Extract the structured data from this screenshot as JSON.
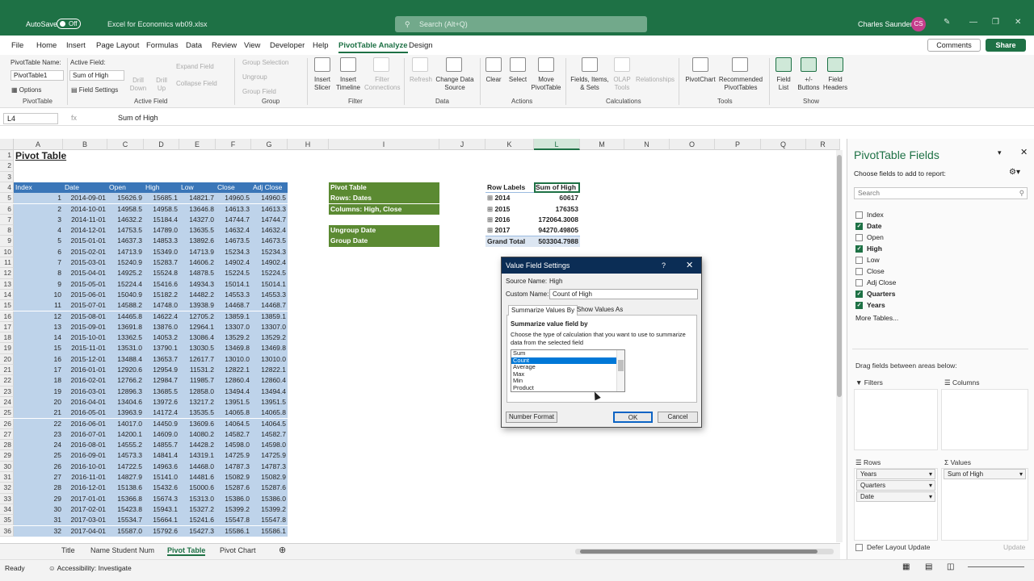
{
  "window": {
    "autosave_label": "AutoSave",
    "autosave_state": "Off",
    "filename": "Excel for Economics wb09.xlsx",
    "search_placeholder": "Search (Alt+Q)",
    "user_name": "Charles Saunders",
    "user_initials": "CS"
  },
  "menu": {
    "tabs": [
      "File",
      "Home",
      "Insert",
      "Page Layout",
      "Formulas",
      "Data",
      "Review",
      "View",
      "Developer",
      "Help",
      "PivotTable Analyze",
      "Design"
    ],
    "active": "PivotTable Analyze",
    "comments": "Comments",
    "share": "Share"
  },
  "ribbon": {
    "pivot_name_label": "PivotTable Name:",
    "pivot_name": "PivotTable1",
    "options": "Options",
    "group_pivot": "PivotTable",
    "active_field_label": "Active Field:",
    "active_field": "Sum of High",
    "field_settings": "Field Settings",
    "drill_down": "Drill Down",
    "drill_up": "Drill Up",
    "expand_field": "Expand Field",
    "collapse_field": "Collapse Field",
    "group_active": "Active Field",
    "group_selection": "Group Selection",
    "ungroup": "Ungroup",
    "group_field": "Group Field",
    "group_group": "Group",
    "insert_slicer": "Insert Slicer",
    "insert_timeline": "Insert Timeline",
    "filter_connections": "Filter Connections",
    "group_filter": "Filter",
    "refresh": "Refresh",
    "change_data_source": "Change Data Source",
    "group_data": "Data",
    "clear": "Clear",
    "select": "Select",
    "move_pivot": "Move PivotTable",
    "group_actions": "Actions",
    "fields_items_sets": "Fields, Items, & Sets",
    "olap_tools": "OLAP Tools",
    "relationships": "Relationships",
    "group_calculations": "Calculations",
    "pivotchart": "PivotChart",
    "recommended": "Recommended PivotTables",
    "group_tools": "Tools",
    "field_list": "Field List",
    "plus_minus": "+/- Buttons",
    "field_headers": "Field Headers",
    "group_show": "Show"
  },
  "formula_bar": {
    "name_box": "L4",
    "fx": "fx",
    "value": "Sum of High"
  },
  "columns": [
    "A",
    "B",
    "C",
    "D",
    "E",
    "F",
    "G",
    "H",
    "I",
    "J",
    "K",
    "L",
    "M",
    "N",
    "O",
    "P",
    "Q",
    "R"
  ],
  "selected_column": "L",
  "rows": [
    "1",
    "2",
    "3",
    "4",
    "5",
    "6",
    "7",
    "8",
    "9",
    "10",
    "11",
    "12",
    "13",
    "14",
    "15",
    "16",
    "17",
    "18",
    "19",
    "20",
    "21",
    "22",
    "23",
    "24",
    "25",
    "26",
    "27",
    "28",
    "29",
    "30",
    "31",
    "32",
    "33",
    "34",
    "35",
    "36"
  ],
  "sheet": {
    "title": "Pivot Table",
    "headers": [
      "Index",
      "Date",
      "Open",
      "High",
      "Low",
      "Close",
      "Adj Close"
    ],
    "data": [
      [
        "1",
        "2014-09-01",
        "15626.9",
        "15685.1",
        "14821.7",
        "14960.5",
        "14960.5"
      ],
      [
        "2",
        "2014-10-01",
        "14958.5",
        "14958.5",
        "13646.8",
        "14613.3",
        "14613.3"
      ],
      [
        "3",
        "2014-11-01",
        "14632.2",
        "15184.4",
        "14327.0",
        "14744.7",
        "14744.7"
      ],
      [
        "4",
        "2014-12-01",
        "14753.5",
        "14789.0",
        "13635.5",
        "14632.4",
        "14632.4"
      ],
      [
        "5",
        "2015-01-01",
        "14637.3",
        "14853.3",
        "13892.6",
        "14673.5",
        "14673.5"
      ],
      [
        "6",
        "2015-02-01",
        "14713.9",
        "15349.0",
        "14713.9",
        "15234.3",
        "15234.3"
      ],
      [
        "7",
        "2015-03-01",
        "15240.9",
        "15283.7",
        "14606.2",
        "14902.4",
        "14902.4"
      ],
      [
        "8",
        "2015-04-01",
        "14925.2",
        "15524.8",
        "14878.5",
        "15224.5",
        "15224.5"
      ],
      [
        "9",
        "2015-05-01",
        "15224.4",
        "15416.6",
        "14934.3",
        "15014.1",
        "15014.1"
      ],
      [
        "10",
        "2015-06-01",
        "15040.9",
        "15182.2",
        "14482.2",
        "14553.3",
        "14553.3"
      ],
      [
        "11",
        "2015-07-01",
        "14588.2",
        "14748.0",
        "13938.9",
        "14468.7",
        "14468.7"
      ],
      [
        "12",
        "2015-08-01",
        "14465.8",
        "14622.4",
        "12705.2",
        "13859.1",
        "13859.1"
      ],
      [
        "13",
        "2015-09-01",
        "13691.8",
        "13876.0",
        "12964.1",
        "13307.0",
        "13307.0"
      ],
      [
        "14",
        "2015-10-01",
        "13362.5",
        "14053.2",
        "13086.4",
        "13529.2",
        "13529.2"
      ],
      [
        "15",
        "2015-11-01",
        "13531.0",
        "13790.1",
        "13030.5",
        "13469.8",
        "13469.8"
      ],
      [
        "16",
        "2015-12-01",
        "13488.4",
        "13653.7",
        "12617.7",
        "13010.0",
        "13010.0"
      ],
      [
        "17",
        "2016-01-01",
        "12920.6",
        "12954.9",
        "11531.2",
        "12822.1",
        "12822.1"
      ],
      [
        "18",
        "2016-02-01",
        "12766.2",
        "12984.7",
        "11985.7",
        "12860.4",
        "12860.4"
      ],
      [
        "19",
        "2016-03-01",
        "12896.3",
        "13685.5",
        "12858.0",
        "13494.4",
        "13494.4"
      ],
      [
        "20",
        "2016-04-01",
        "13404.6",
        "13972.6",
        "13217.2",
        "13951.5",
        "13951.5"
      ],
      [
        "21",
        "2016-05-01",
        "13963.9",
        "14172.4",
        "13535.5",
        "14065.8",
        "14065.8"
      ],
      [
        "22",
        "2016-06-01",
        "14017.0",
        "14450.9",
        "13609.6",
        "14064.5",
        "14064.5"
      ],
      [
        "23",
        "2016-07-01",
        "14200.1",
        "14609.0",
        "14080.2",
        "14582.7",
        "14582.7"
      ],
      [
        "24",
        "2016-08-01",
        "14555.2",
        "14855.7",
        "14428.2",
        "14598.0",
        "14598.0"
      ],
      [
        "25",
        "2016-09-01",
        "14573.3",
        "14841.4",
        "14319.1",
        "14725.9",
        "14725.9"
      ],
      [
        "26",
        "2016-10-01",
        "14722.5",
        "14963.6",
        "14468.0",
        "14787.3",
        "14787.3"
      ],
      [
        "27",
        "2016-11-01",
        "14827.9",
        "15141.0",
        "14481.6",
        "15082.9",
        "15082.9"
      ],
      [
        "28",
        "2016-12-01",
        "15138.6",
        "15432.6",
        "15000.6",
        "15287.6",
        "15287.6"
      ],
      [
        "29",
        "2017-01-01",
        "15366.8",
        "15674.3",
        "15313.0",
        "15386.0",
        "15386.0"
      ],
      [
        "30",
        "2017-02-01",
        "15423.8",
        "15943.1",
        "15327.2",
        "15399.2",
        "15399.2"
      ],
      [
        "31",
        "2017-03-01",
        "15534.7",
        "15664.1",
        "15241.6",
        "15547.8",
        "15547.8"
      ],
      [
        "32",
        "2017-04-01",
        "15587.0",
        "15792.6",
        "15427.3",
        "15586.1",
        "15586.1"
      ]
    ],
    "notes": [
      "Pivot Table",
      "Rows: Dates",
      "Columns: High, Close"
    ],
    "group_notes": [
      "Ungroup Date",
      "Group Date"
    ],
    "pivot": {
      "row_labels": "Row Labels",
      "value_header": "Sum of High",
      "rows": [
        [
          "2014",
          "60617"
        ],
        [
          "2015",
          "176353"
        ],
        [
          "2016",
          "172064.3008"
        ],
        [
          "2017",
          "94270.49805"
        ]
      ],
      "grand_total_label": "Grand Total",
      "grand_total": "503304.7988"
    }
  },
  "dialog": {
    "title": "Value Field Settings",
    "help": "?",
    "close": "✕",
    "source_label": "Source Name:",
    "source_value": "High",
    "custom_label": "Custom Name:",
    "custom_value": "Count of High",
    "tab1": "Summarize Values By",
    "tab2": "Show Values As",
    "section": "Summarize value field by",
    "description": "Choose the type of calculation that you want to use to summarize data from the selected field",
    "options": [
      "Sum",
      "Count",
      "Average",
      "Max",
      "Min",
      "Product"
    ],
    "selected": "Count",
    "number_format": "Number Format",
    "ok": "OK",
    "cancel": "Cancel"
  },
  "pane": {
    "title": "PivotTable Fields",
    "subtitle": "Choose fields to add to report:",
    "search": "Search",
    "fields": [
      {
        "name": "Index",
        "checked": false
      },
      {
        "name": "Date",
        "checked": true
      },
      {
        "name": "Open",
        "checked": false
      },
      {
        "name": "High",
        "checked": true
      },
      {
        "name": "Low",
        "checked": false
      },
      {
        "name": "Close",
        "checked": false
      },
      {
        "name": "Adj Close",
        "checked": false
      },
      {
        "name": "Quarters",
        "checked": true
      },
      {
        "name": "Years",
        "checked": true
      }
    ],
    "more_tables": "More Tables...",
    "drag_label": "Drag fields between areas below:",
    "filters": "Filters",
    "columns_label": "Columns",
    "rows_label": "Rows",
    "values_label": "Values",
    "rows_items": [
      "Years",
      "Quarters",
      "Date"
    ],
    "values_items": [
      "Sum of High"
    ],
    "defer": "Defer Layout Update",
    "update": "Update"
  },
  "tabs": {
    "items": [
      "Title",
      "Name Student Num",
      "Pivot Table",
      "Pivot Chart"
    ],
    "active": "Pivot Table"
  },
  "status": {
    "ready": "Ready",
    "accessibility": "Accessibility: Investigate"
  },
  "colors": {
    "brand": "#1e7145",
    "header_blue": "#3a76b8",
    "data_blue": "#bed3ea",
    "note_green": "#5b8a32",
    "dialog_title": "#0b2d55"
  }
}
